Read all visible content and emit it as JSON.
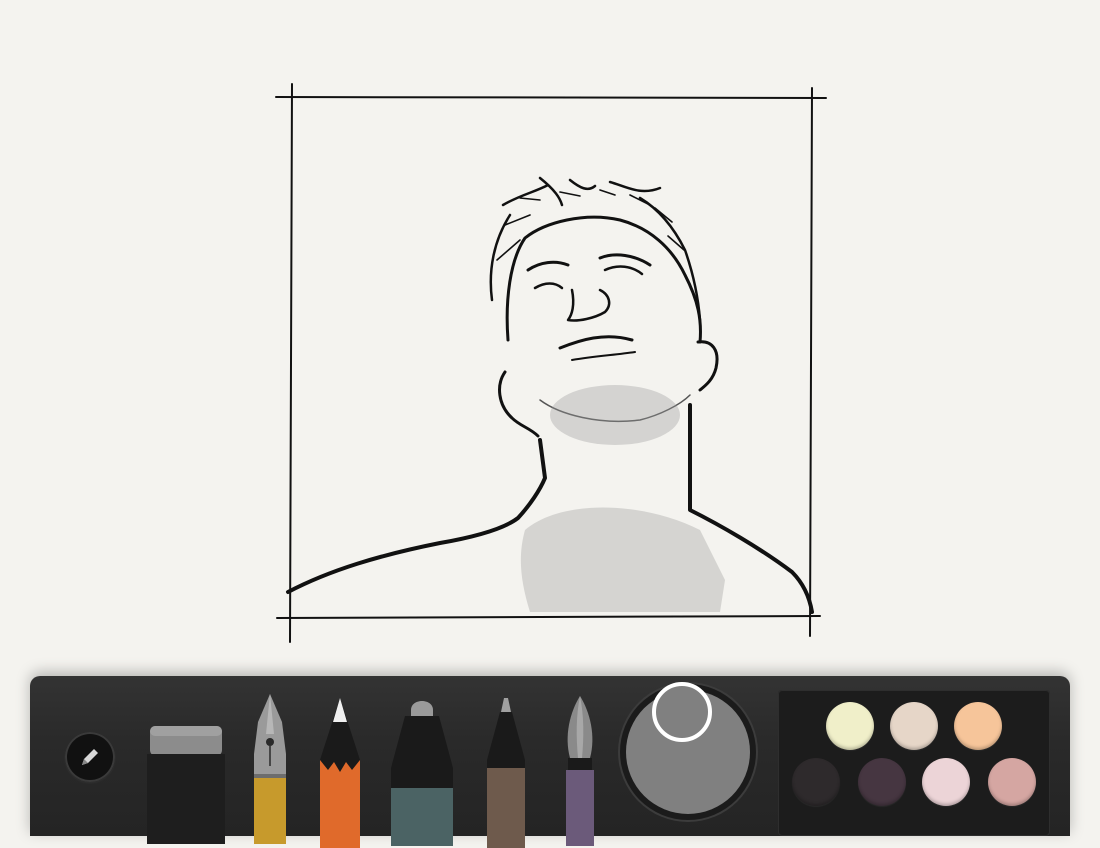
{
  "canvas": {
    "background_color": "#f4f3ef",
    "drawing": "pencil-sketch-portrait-in-hand-drawn-frame"
  },
  "toolbar": {
    "menu_icon": "pencil-icon",
    "tools": [
      {
        "name": "eraser",
        "icon": "eraser-icon"
      },
      {
        "name": "fountain-pen",
        "icon": "fountain-pen-icon",
        "band_color": "#c79a2c"
      },
      {
        "name": "pencil",
        "icon": "pencil-icon",
        "band_color": "#e06a2b"
      },
      {
        "name": "marker",
        "icon": "marker-icon",
        "band_color": "#4b6364"
      },
      {
        "name": "pen",
        "icon": "pen-icon",
        "band_color": "#6e5a4c"
      },
      {
        "name": "brush",
        "icon": "brush-icon",
        "band_color": "#6b5a7a"
      }
    ],
    "current_color": "#808080",
    "palette": [
      "#f0efc9",
      "#e6d6c8",
      "#f6c59a",
      "#2e2a2c",
      "#463641",
      "#ecd4d7",
      "#d5a6a2"
    ]
  }
}
